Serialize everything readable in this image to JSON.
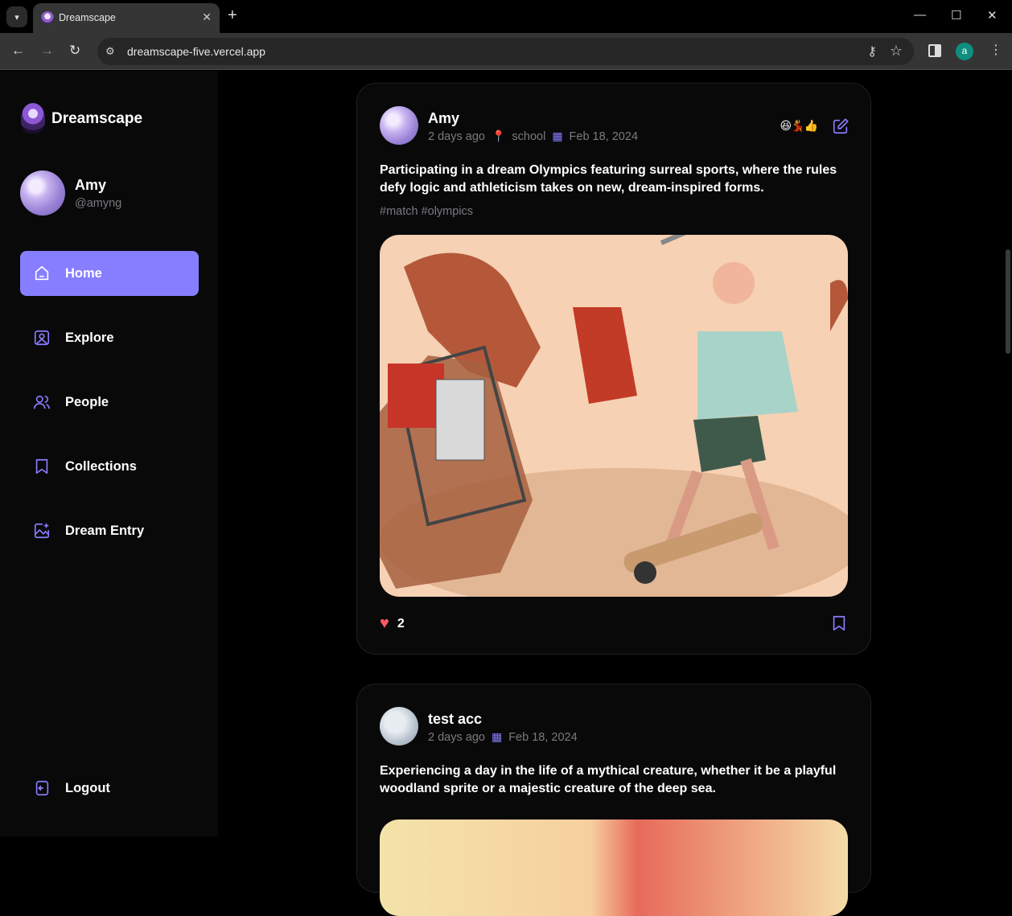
{
  "browser": {
    "tab_title": "Dreamscape",
    "url": "dreamscape-five.vercel.app",
    "profile_initial": "a"
  },
  "sidebar": {
    "brand": "Dreamscape",
    "user": {
      "name": "Amy",
      "handle": "@amyng"
    },
    "nav": [
      {
        "label": "Home",
        "icon": "home-icon",
        "active": true
      },
      {
        "label": "Explore",
        "icon": "explore-icon",
        "active": false
      },
      {
        "label": "People",
        "icon": "people-icon",
        "active": false
      },
      {
        "label": "Collections",
        "icon": "bookmark-icon",
        "active": false
      },
      {
        "label": "Dream Entry",
        "icon": "image-add-icon",
        "active": false
      }
    ],
    "logout_label": "Logout"
  },
  "posts": [
    {
      "author": "Amy",
      "time": "2 days ago",
      "location": "school",
      "date": "Feb 18, 2024",
      "reactions": "😆💃👍",
      "caption": "Participating in a dream Olympics featuring surreal sports, where the rules defy logic and athleticism takes on new, dream-inspired forms.",
      "tags": "#match #olympics",
      "likes": "2"
    },
    {
      "author": "test acc",
      "time": "2 days ago",
      "date": "Feb 18, 2024",
      "caption": "Experiencing a day in the life of a mythical creature, whether it be a playful woodland sprite or a majestic creature of the deep sea."
    }
  ],
  "colors": {
    "accent": "#877eff",
    "muted": "#7a7a80",
    "card": "#09090a"
  }
}
